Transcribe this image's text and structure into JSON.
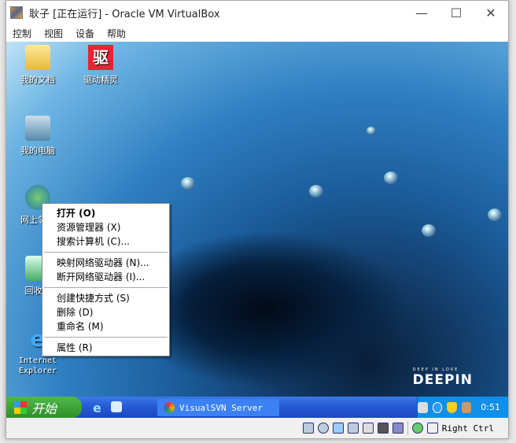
{
  "window": {
    "title": "耿子 [正在运行] - Oracle VM VirtualBox",
    "minimize": "—",
    "maximize": "☐",
    "close": "✕"
  },
  "menu": [
    "控制",
    "视图",
    "设备",
    "帮助"
  ],
  "desktop_icons": [
    "我的文档",
    "驱动精灵",
    "我的电脑",
    "网上邻居",
    "回收站",
    "Internet Explorer"
  ],
  "context_menu": {
    "open": "打开 (O)",
    "explore": "资源管理器 (X)",
    "search": "搜索计算机 (C)...",
    "map_drive": "映射网络驱动器 (N)...",
    "disconnect_drive": "断开网络驱动器 (I)...",
    "create_shortcut": "创建快捷方式 (S)",
    "delete": "删除 (D)",
    "rename": "重命名 (M)",
    "properties": "属性 (R)"
  },
  "taskbar": {
    "start": "开始",
    "task": "VisualSVN Server",
    "clock": "0:51"
  },
  "wallpaper": {
    "brand": "DEEPIN",
    "tagline": "DEEP IN LOVE"
  },
  "status": {
    "host_key": "Right Ctrl"
  }
}
